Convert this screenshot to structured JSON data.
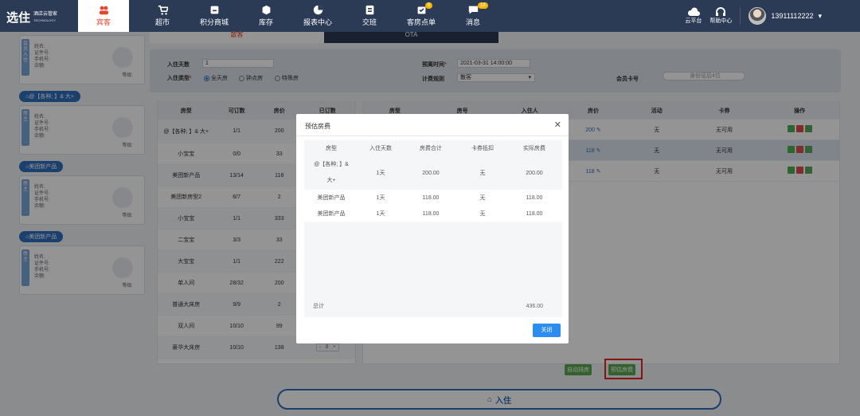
{
  "app": {
    "logo_main": "选住",
    "logo_sub": "酒店云管家",
    "logo_tag": "TECHNOLOGY"
  },
  "nav": {
    "items": [
      {
        "label": "宾客",
        "icon": "users-icon",
        "active": true
      },
      {
        "label": "超市",
        "icon": "cart-icon"
      },
      {
        "label": "积分商城",
        "icon": "store-icon"
      },
      {
        "label": "库存",
        "icon": "box-icon"
      },
      {
        "label": "报表中心",
        "icon": "chart-pie-icon"
      },
      {
        "label": "交班",
        "icon": "handover-icon"
      },
      {
        "label": "客房点单",
        "icon": "order-icon",
        "badge": "0"
      },
      {
        "label": "消息",
        "icon": "message-icon",
        "badge": "18"
      }
    ],
    "cloud_label": "云平台",
    "help_label": "帮助中心",
    "user_phone": "13911112222"
  },
  "left_panel": {
    "cards": [
      {
        "tag": "会员入住",
        "name": "姓名:",
        "id": "证件号:",
        "phone": "手机号:",
        "balance": "余额:",
        "level": "等级:"
      },
      {
        "group": "@【各种; 】& 大+",
        "tag": "房主",
        "name": "姓名:",
        "id": "证件号:",
        "phone": "手机号:",
        "balance": "余额:",
        "level": "等级:"
      },
      {
        "group": "美团新产品",
        "tag": "房主",
        "name": "姓名:",
        "id": "证件号:",
        "phone": "手机号:",
        "balance": "余额:",
        "level": "等级:"
      },
      {
        "group": "美团新产品",
        "tag": "房主",
        "name": "姓名:",
        "id": "证件号:",
        "phone": "手机号:",
        "balance": "余额:",
        "level": "等级:"
      }
    ]
  },
  "tabs": [
    "散客",
    "OTA"
  ],
  "form": {
    "days_label": "入住天数",
    "days_value": "1",
    "type_label": "入住类型",
    "types": [
      "全天房",
      "钟点房",
      "特殊房"
    ],
    "leave_label": "预离时间",
    "leave_value": "2021-03-31 14:00:00",
    "rule_label": "计费规则",
    "rule_value": "散客",
    "member_label": "会员卡号",
    "member_placeholder": "身份证后4位"
  },
  "left_table": {
    "headers": [
      "房型",
      "可订数",
      "房价",
      "已订数"
    ],
    "rows": [
      {
        "type": "@【各种; 】& 大+",
        "avail": "1/1",
        "price": "200"
      },
      {
        "type": "小宝宝",
        "avail": "0/0",
        "price": "33"
      },
      {
        "type": "美团新产品",
        "avail": "13/14",
        "price": "118"
      },
      {
        "type": "美团新房型2",
        "avail": "6/7",
        "price": "2"
      },
      {
        "type": "小宝宝",
        "avail": "1/1",
        "price": "333"
      },
      {
        "type": "二宝宝",
        "avail": "3/3",
        "price": "33"
      },
      {
        "type": "大宝宝",
        "avail": "1/1",
        "price": "222"
      },
      {
        "type": "单人间",
        "avail": "28/32",
        "price": "200"
      },
      {
        "type": "普通大床房",
        "avail": "9/9",
        "price": "2"
      },
      {
        "type": "双人间",
        "avail": "10/10",
        "price": "99"
      },
      {
        "type": "豪华大床房",
        "avail": "10/10",
        "price": "138",
        "stepper": {
          "minus": "-",
          "value": "0",
          "plus": "+"
        }
      }
    ]
  },
  "right_table": {
    "headers": [
      "房型",
      "房号",
      "入住人",
      "房价",
      "活动",
      "卡券",
      "操作"
    ],
    "rows": [
      {
        "price": "200",
        "activity": "无",
        "coupon": "无可用"
      },
      {
        "price": "118",
        "activity": "无",
        "coupon": "无可用"
      },
      {
        "price": "118",
        "activity": "无",
        "coupon": "无可用"
      }
    ]
  },
  "buttons": {
    "auto_assign": "自动排房",
    "estimate": "预估房费",
    "checkin": "入住"
  },
  "modal": {
    "title": "预估房费",
    "headers": [
      "房型",
      "入住天数",
      "房费合计",
      "卡券抵扣",
      "实际房费"
    ],
    "rows": [
      {
        "type": "@【各种; 】& 大+",
        "days": "1天",
        "total": "200.00",
        "coupon": "无",
        "actual": "200.00"
      },
      {
        "type": "美团新产品",
        "days": "1天",
        "total": "118.00",
        "coupon": "无",
        "actual": "118.00"
      },
      {
        "type": "美团新产品",
        "days": "1天",
        "total": "118.00",
        "coupon": "无",
        "actual": "118.00"
      }
    ],
    "total_label": "总计",
    "total_value": "436.00",
    "close_label": "关闭"
  }
}
